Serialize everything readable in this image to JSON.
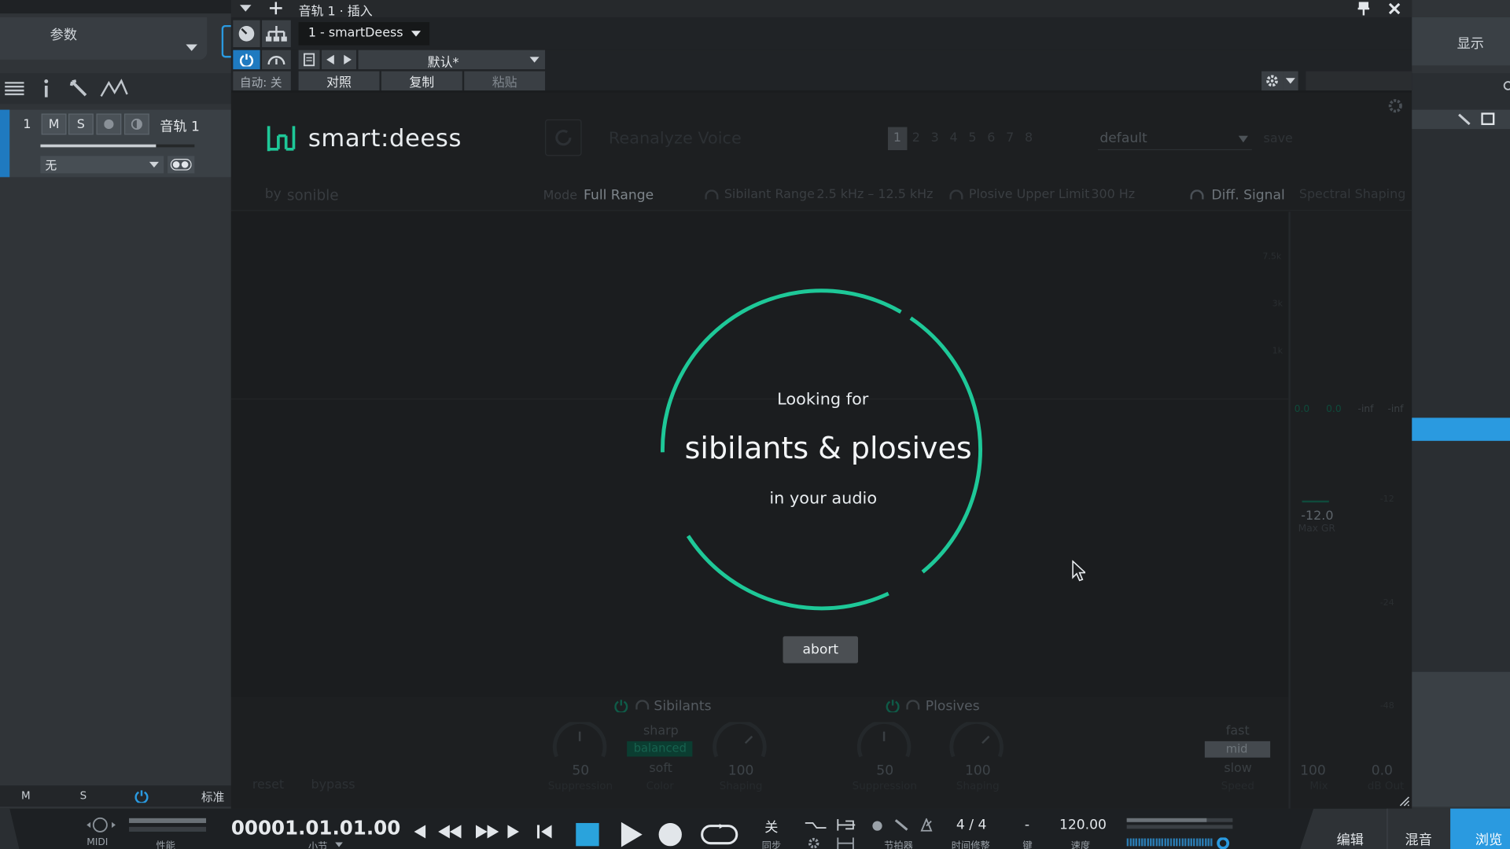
{
  "studio": {
    "params_tab": "参数",
    "display_tab": "显示",
    "track": {
      "number": "1",
      "mute": "M",
      "solo": "S",
      "name": "音轨 1",
      "input": "无"
    },
    "bottom": {
      "m": "M",
      "s": "S",
      "std": "标准"
    }
  },
  "plugin_window": {
    "title": "音轨 1 · 插入",
    "plugin_select": "1 - smartDeess",
    "preset": "默认*",
    "auto_label": "自动: 关",
    "compare": "对照",
    "copy": "复制",
    "paste": "粘贴"
  },
  "smartdeess": {
    "logo": "smart:deess",
    "byline": "by",
    "brand": "sonible",
    "reanalyze": "Reanalyze Voice",
    "slots": [
      "1",
      "2",
      "3",
      "4",
      "5",
      "6",
      "7",
      "8"
    ],
    "preset": "default",
    "save": "save",
    "mode_label": "Mode",
    "mode_value": "Full Range",
    "sibilant_range_label": "Sibilant Range",
    "sibilant_range_value": "2.5 kHz – 12.5 kHz",
    "plosive_label": "Plosive Upper Limit",
    "plosive_value": "300 Hz",
    "diff_signal": "Diff. Signal",
    "spectral_shaping": "Spectral Shaping",
    "freq_labels": [
      "7.5k",
      "3k",
      "1k"
    ],
    "meter_values": [
      "0.0",
      "0.0",
      "-inf",
      "-inf"
    ],
    "db_labels": [
      "-12",
      "-24",
      "-48"
    ],
    "max_gr_value": "-12.0",
    "max_gr_label": "Max GR",
    "overlay": {
      "line1": "Looking for",
      "line2": "sibilants & plosives",
      "line3": "in your audio",
      "abort": "abort"
    },
    "sibilants": {
      "title": "Sibilants",
      "suppression_value": "50",
      "suppression_label": "Suppression",
      "color_options": [
        "sharp",
        "balanced",
        "soft"
      ],
      "color_label": "Color",
      "shaping_value": "100",
      "shaping_label": "Shaping"
    },
    "plosives": {
      "title": "Plosives",
      "suppression_value": "50",
      "suppression_label": "Suppression",
      "shaping_value": "100",
      "shaping_label": "Shaping"
    },
    "speed": {
      "options": [
        "fast",
        "mid",
        "slow"
      ],
      "label": "Speed"
    },
    "mix": {
      "value": "100",
      "label": "Mix"
    },
    "out": {
      "value": "0.0",
      "label": "dB Out"
    },
    "reset": "reset",
    "bypass": "bypass"
  },
  "transport": {
    "midi": "MIDI",
    "perf": "性能",
    "time": "00001.01.01.00",
    "time_unit": "小节",
    "sync_value": "关",
    "sync_label": "同步",
    "metronome": "节拍器",
    "signature": "4 / 4",
    "signature_label": "时间修整",
    "key_value": "-",
    "key_label": "键",
    "tempo": "120.00",
    "tempo_label": "速度",
    "tabs": [
      "编辑",
      "混音",
      "浏览"
    ]
  },
  "colors": {
    "accent": "#1ec898",
    "s1blue": "#2a9ae0"
  }
}
